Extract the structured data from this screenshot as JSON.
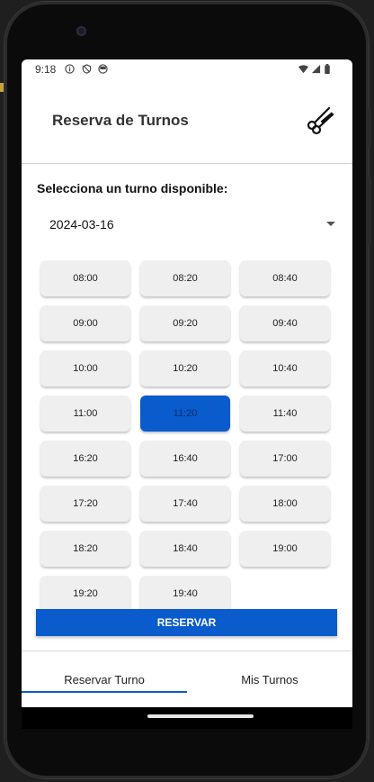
{
  "status_bar": {
    "time": "9:18",
    "left_icons": [
      "info-icon",
      "shield-icon",
      "data-saver-icon"
    ],
    "right_icons": [
      "wifi-icon",
      "signal-icon",
      "battery-icon"
    ]
  },
  "app_bar": {
    "title": "Reserva de Turnos",
    "logo_icon": "scissors-comb-icon"
  },
  "booking": {
    "prompt": "Selecciona un turno disponible:",
    "selected_date": "2024-03-16",
    "slots": [
      "08:00",
      "08:20",
      "08:40",
      "09:00",
      "09:20",
      "09:40",
      "10:00",
      "10:20",
      "10:40",
      "11:00",
      "11:20",
      "11:40",
      "16:20",
      "16:40",
      "17:00",
      "17:20",
      "17:40",
      "18:00",
      "18:20",
      "18:40",
      "19:00",
      "19:20",
      "19:40"
    ],
    "selected_slot": "11:20",
    "reserve_label": "RESERVAR"
  },
  "bottom_nav": {
    "tabs": [
      {
        "label": "Reservar Turno",
        "active": true
      },
      {
        "label": "Mis Turnos",
        "active": false
      }
    ]
  },
  "colors": {
    "accent": "#0a5bcc",
    "slot_bg": "#efefef",
    "selected_text": "#0a2f6d"
  }
}
